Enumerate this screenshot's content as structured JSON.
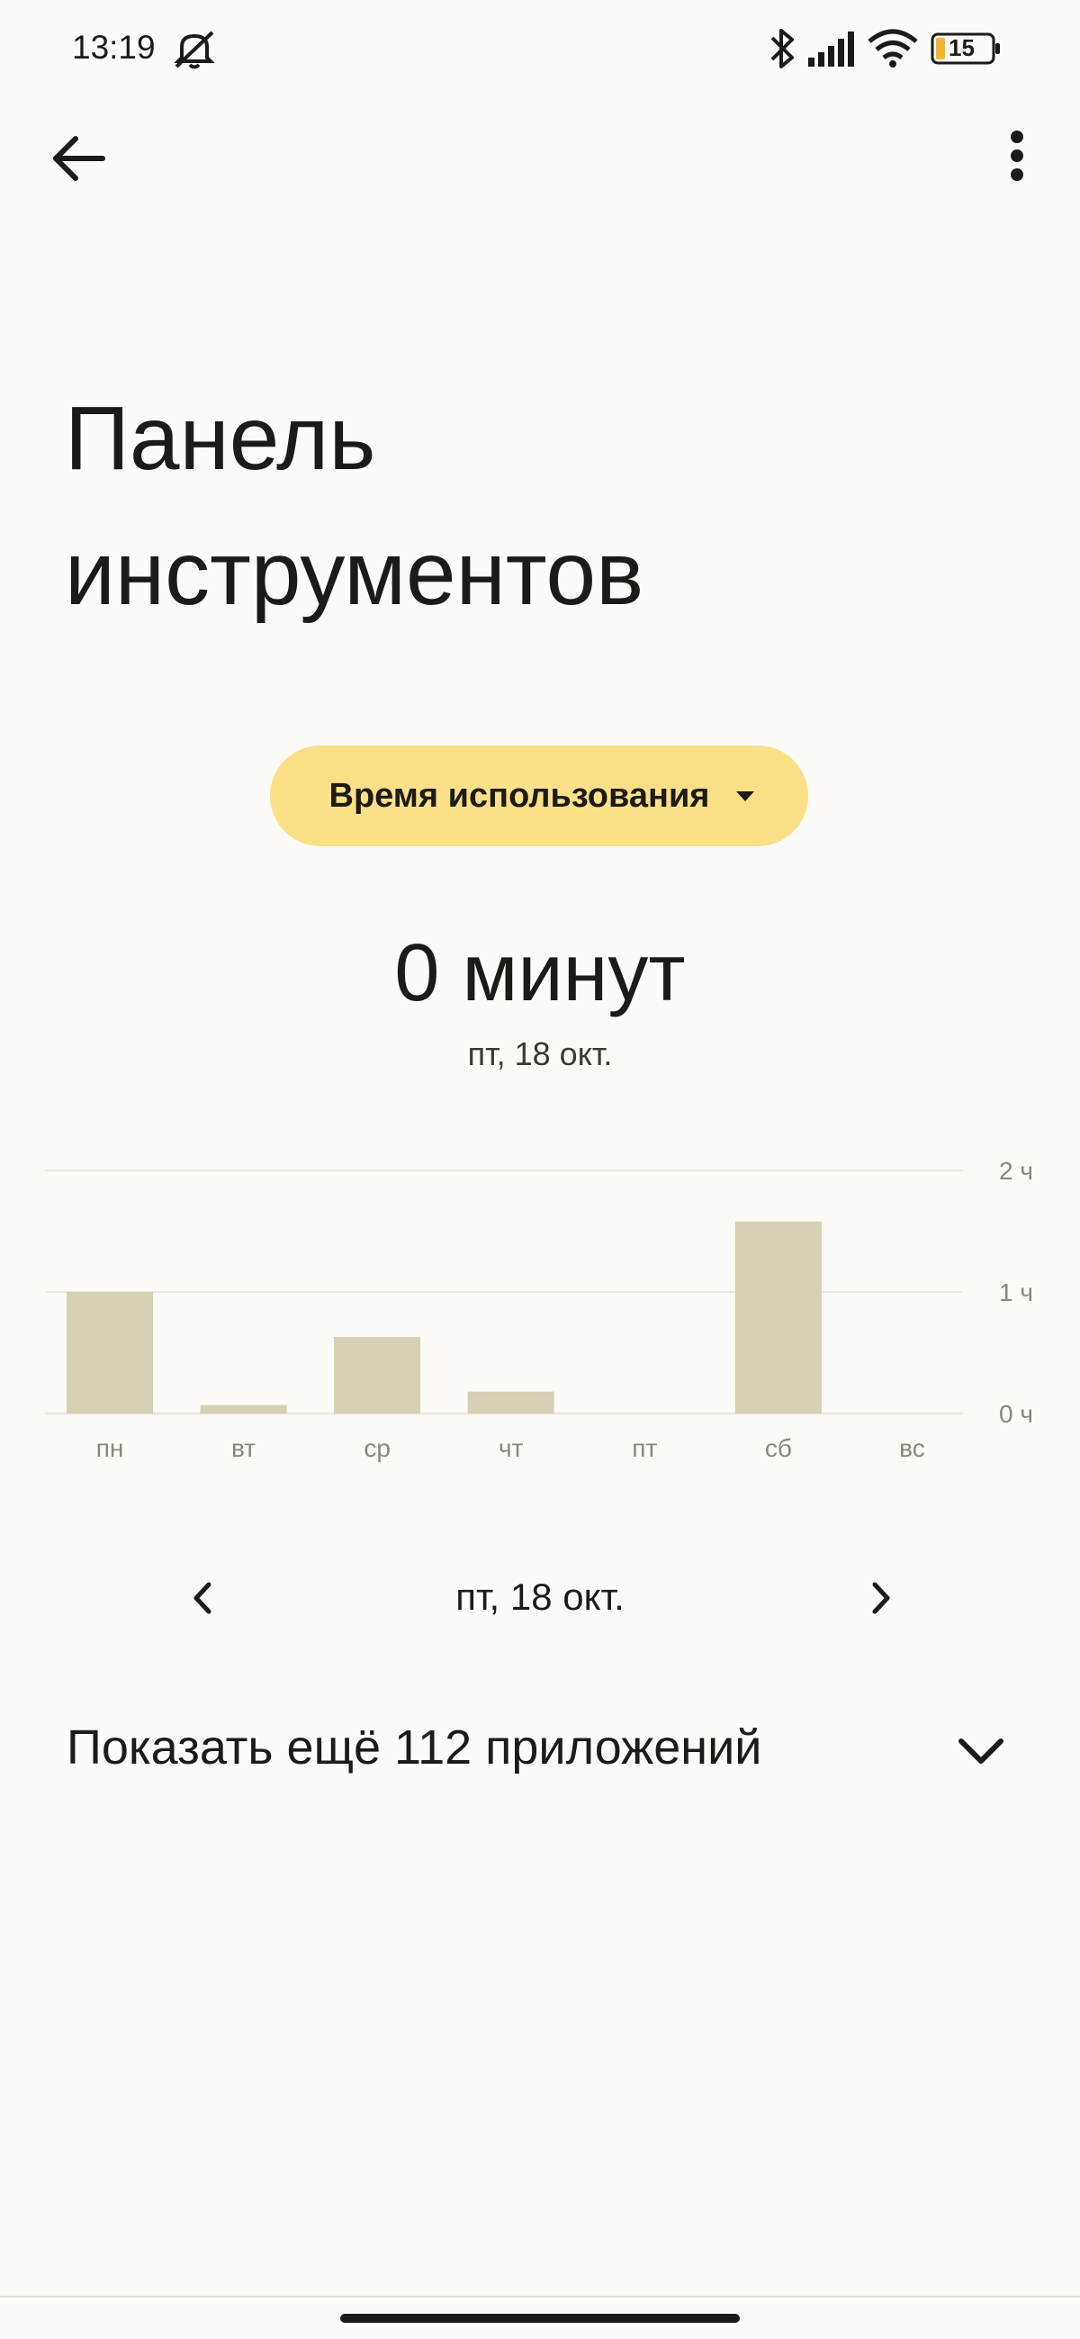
{
  "status_bar": {
    "time": "13:19",
    "battery": "15",
    "icons": [
      "mute-icon",
      "bluetooth-icon",
      "signal-icon",
      "wifi-icon",
      "battery-icon"
    ]
  },
  "app_bar": {
    "back_icon": "arrow-left-icon",
    "menu_icon": "more-vert-icon"
  },
  "page": {
    "title_line1": "Панель",
    "title_line2": "инструментов"
  },
  "metric_selector": {
    "label": "Время использования",
    "icon": "dropdown-triangle-icon"
  },
  "summary": {
    "value": "0 минут",
    "date": "пт, 18 окт."
  },
  "chart_data": {
    "type": "bar",
    "categories": [
      "пн",
      "вт",
      "ср",
      "чт",
      "пт",
      "сб",
      "вс"
    ],
    "values": [
      1.0,
      0.07,
      0.63,
      0.18,
      0,
      1.58,
      0
    ],
    "y_ticks": [
      "0 ч",
      "1 ч",
      "2 ч"
    ],
    "ylim": [
      0,
      2
    ],
    "grid": true,
    "bar_color": "#d6d0b4",
    "axis_color": "#ece9e1"
  },
  "day_nav": {
    "label": "пт, 18 окт.",
    "prev_icon": "chevron-left-icon",
    "next_icon": "chevron-right-icon"
  },
  "show_more": {
    "label": "Показать ещё 112 приложений",
    "icon": "chevron-down-icon"
  },
  "colors": {
    "background": "#fdfbf7",
    "chip": "#fbe087",
    "text": "#1c1b17",
    "muted": "#8b877c"
  }
}
